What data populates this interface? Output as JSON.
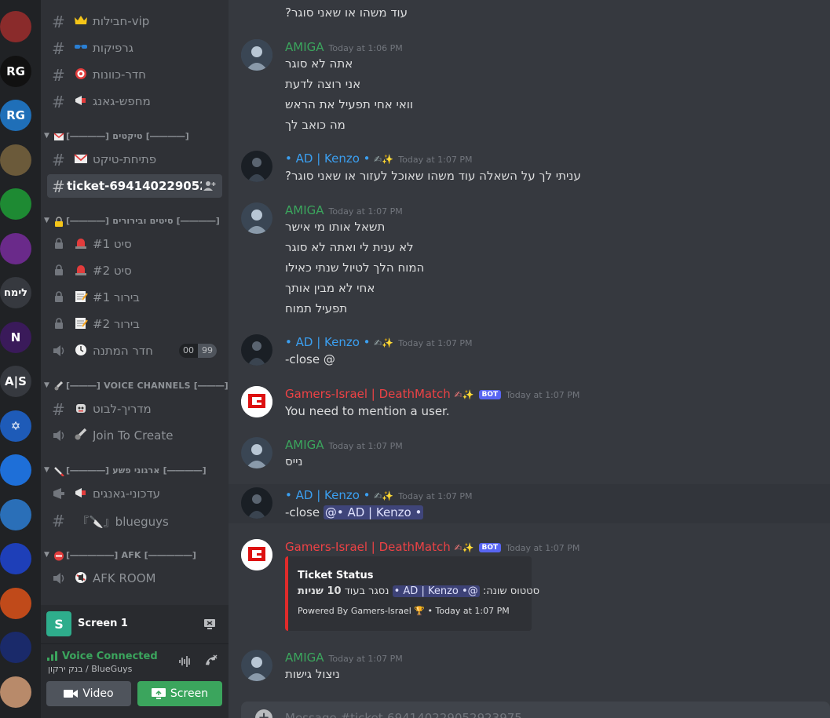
{
  "servers": [
    {
      "name": "server-1",
      "color": "#8a2b2b",
      "text": ""
    },
    {
      "name": "server-2",
      "color": "#111111",
      "text": "RG"
    },
    {
      "name": "server-3",
      "color": "#1f6fb8",
      "text": "RG"
    },
    {
      "name": "server-4",
      "color": "#6b5a3a",
      "text": ""
    },
    {
      "name": "server-5",
      "color": "#1e8a33",
      "text": ""
    },
    {
      "name": "server-6",
      "color": "#6a2a8a",
      "text": ""
    },
    {
      "name": "server-7",
      "color": "#36393f",
      "text": "לימח"
    },
    {
      "name": "server-8",
      "color": "#3a1a5a",
      "text": "N"
    },
    {
      "name": "server-9",
      "color": "#36393f",
      "text": "A|S"
    },
    {
      "name": "server-10",
      "color": "#1e5bb8",
      "text": "✡"
    },
    {
      "name": "server-11",
      "color": "#1e6fd8",
      "text": ""
    },
    {
      "name": "server-12",
      "color": "#2a6fb8",
      "text": ""
    },
    {
      "name": "server-13",
      "color": "#1e3fb8",
      "text": ""
    },
    {
      "name": "server-14",
      "color": "#c04a1a",
      "text": ""
    },
    {
      "name": "server-15",
      "color": "#1a2a6a",
      "text": ""
    },
    {
      "name": "server-16",
      "color": "#b88a6a",
      "text": ""
    }
  ],
  "channels": {
    "vip": "חבילות-vip",
    "graphics": "גרפיקות",
    "aim_room": "חדר-כוונות",
    "gang_search": "מחפש-גאנג",
    "cat_tickets": "[――――] טיקטים [――――]",
    "open_ticket": "פתיחת-טיקט",
    "current_ticket": "ticket-694140229052...",
    "cat_sits": "[――――] סיטים ובירורים [――――]",
    "sit1": "סיט #1",
    "sit2": "סיט #2",
    "check1": "בירור #1",
    "check2": "בירור #2",
    "waiting_room": "חדר המתנה",
    "waiting_count_a": "00",
    "waiting_count_b": "99",
    "cat_voice": "[―――] VOICE CHANNELS [―――]",
    "bot_guide": "מדריך-לבוט",
    "join_to_create": "Join To Create",
    "cat_crime": "[――――] ארגוני פשע [――――]",
    "gang_updates": "עדכוני-גאנגים",
    "blueguys": "『🔪』blueguys",
    "cat_afk": "[―――――] AFK [―――――]",
    "afk_room": "AFK ROOM"
  },
  "screen_panel": {
    "label": "Screen 1",
    "badge": "S"
  },
  "voice": {
    "status": "Voice Connected",
    "location": "בנק ירקון / BlueGuys",
    "video_label": "Video",
    "screen_label": "Screen"
  },
  "colors": {
    "amiga": "#3ba55d",
    "kenzo": "#3b9ff0",
    "gamers": "#ed4245",
    "voice_green": "#3ba55d",
    "screen_btn": "#3ba55d",
    "video_btn": "#4f545c"
  },
  "messages": [
    {
      "id": "m0",
      "lines": [
        "עוד משהו או שאני סוגר?"
      ]
    },
    {
      "id": "m1",
      "author": "AMIGA",
      "time": "Today at 1:06 PM",
      "lines": [
        "אתה לא סוגר",
        "אני רוצה לדעת",
        "וואי אחי תפעיל את הראש",
        "מה כואב לך"
      ]
    },
    {
      "id": "m2",
      "author": "• AD | Kenzo •",
      "time": "Today at 1:07 PM",
      "lines": [
        "עניתי לך על השאלה עוד משהו שאוכל לעזור או שאני סוגר?"
      ]
    },
    {
      "id": "m3",
      "author": "AMIGA",
      "time": "Today at 1:07 PM",
      "lines": [
        "תשאל אותו מי אישר",
        "לא ענית לי ואתה לא סוגר",
        "המוח הלך לטיול שנתי כאילו",
        "אחי לא מבין אותך",
        "תפעיל תמוח"
      ]
    },
    {
      "id": "m4",
      "author": "• AD | Kenzo •",
      "time": "Today at 1:07 PM",
      "lines": [
        "-close @"
      ]
    },
    {
      "id": "m5",
      "author": "Gamers-Israel | DeathMatch",
      "bot": "BOT",
      "time": "Today at 1:07 PM",
      "lines": [
        "You need to mention a user."
      ]
    },
    {
      "id": "m6",
      "author": "AMIGA",
      "time": "Today at 1:07 PM",
      "lines": [
        "נייס"
      ]
    },
    {
      "id": "m7",
      "author": "• AD | Kenzo •",
      "time": "Today at 1:07 PM",
      "prefix": "-close",
      "mention": "@• AD | Kenzo •"
    },
    {
      "id": "m8",
      "author": "Gamers-Israel | DeathMatch",
      "bot": "BOT",
      "time": "Today at 1:07 PM",
      "embed": {
        "title": "Ticket Status",
        "body_prefix": "סטטוס שונה:",
        "body_mention": "@• AD | Kenzo •",
        "body_suffix": "נסגר בעוד",
        "body_bold": "10 שניות",
        "footer": "Powered By Gamers-Israel 🏆",
        "footer_time": "• Today at 1:07 PM"
      }
    },
    {
      "id": "m9",
      "author": "AMIGA",
      "time": "Today at 1:07 PM",
      "lines": [
        "ניצול גישות"
      ]
    }
  ],
  "composer": {
    "placeholder": "Message #ticket-694140229052923975"
  }
}
